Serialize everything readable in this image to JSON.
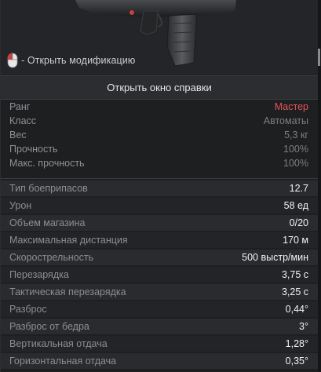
{
  "hint": {
    "text": "- Открыть модификацию",
    "icon": "mouse-left-click-icon"
  },
  "help_button": {
    "label": "Открыть окно справки"
  },
  "info": [
    {
      "label": "Ранг",
      "value": "Мастер",
      "highlight": true
    },
    {
      "label": "Класс",
      "value": "Автоматы"
    },
    {
      "label": "Вес",
      "value": "5,3 кг"
    },
    {
      "label": "Прочность",
      "value": "100%"
    },
    {
      "label": "Макс. прочность",
      "value": "100%"
    }
  ],
  "stats": [
    {
      "label": "Тип боеприпасов",
      "value": "12.7"
    },
    {
      "label": "Урон",
      "value": "58 ед"
    },
    {
      "label": "Объем магазина",
      "value": "0/20"
    },
    {
      "label": "Максимальная дистанция",
      "value": "170 м"
    },
    {
      "label": "Скорострельность",
      "value": "500 выстр/мин"
    },
    {
      "label": "Перезарядка",
      "value": "3,75 с"
    },
    {
      "label": "Тактическая перезарядка",
      "value": "3,25 с"
    },
    {
      "label": "Разброс",
      "value": "0,44°"
    },
    {
      "label": "Разброс от бедра",
      "value": "3°"
    },
    {
      "label": "Вертикальная отдача",
      "value": "1,28°"
    },
    {
      "label": "Горизонтальная отдача",
      "value": "0,35°"
    }
  ],
  "colors": {
    "rank": "#e0555a",
    "accent_red": "#c8403f"
  }
}
